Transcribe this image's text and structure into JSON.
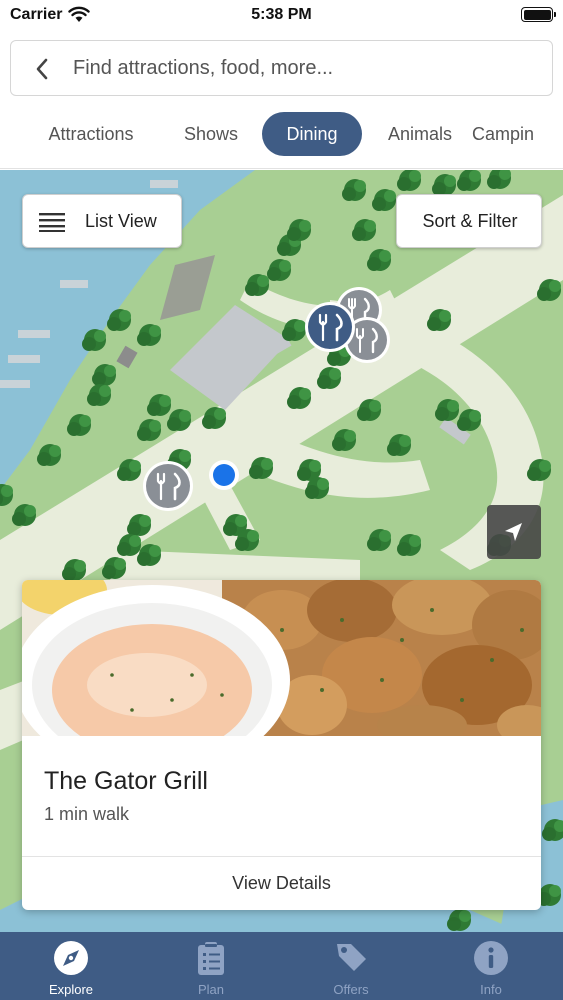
{
  "status_bar": {
    "carrier": "Carrier",
    "time": "5:38 PM"
  },
  "search": {
    "placeholder": "Find attractions, food, more..."
  },
  "category_tabs": [
    {
      "label": "Attractions",
      "active": false
    },
    {
      "label": "Shows",
      "active": false
    },
    {
      "label": "Dining",
      "active": true
    },
    {
      "label": "Animals",
      "active": false
    },
    {
      "label": "Campin",
      "active": false
    }
  ],
  "map": {
    "list_view_label": "List View",
    "sort_filter_label": "Sort & Filter",
    "pins": [
      "dining-pin",
      "dining-pin",
      "dining-pin",
      "dining-pin"
    ],
    "user_location": "blue-dot"
  },
  "card": {
    "title": "The Gator Grill",
    "subtitle": "1 min walk",
    "button_label": "View Details"
  },
  "tab_bar": [
    {
      "label": "Explore",
      "icon": "compass-icon",
      "active": true
    },
    {
      "label": "Plan",
      "icon": "clipboard-icon",
      "active": false
    },
    {
      "label": "Offers",
      "icon": "tag-icon",
      "active": false
    },
    {
      "label": "Info",
      "icon": "info-icon",
      "active": false
    }
  ],
  "colors": {
    "accent": "#3f5c85",
    "water": "#8cc1d6",
    "grass": "#a8cf93",
    "path": "#e8eddb",
    "tree": "#2f7a34",
    "location_dot": "#1a73e8"
  }
}
